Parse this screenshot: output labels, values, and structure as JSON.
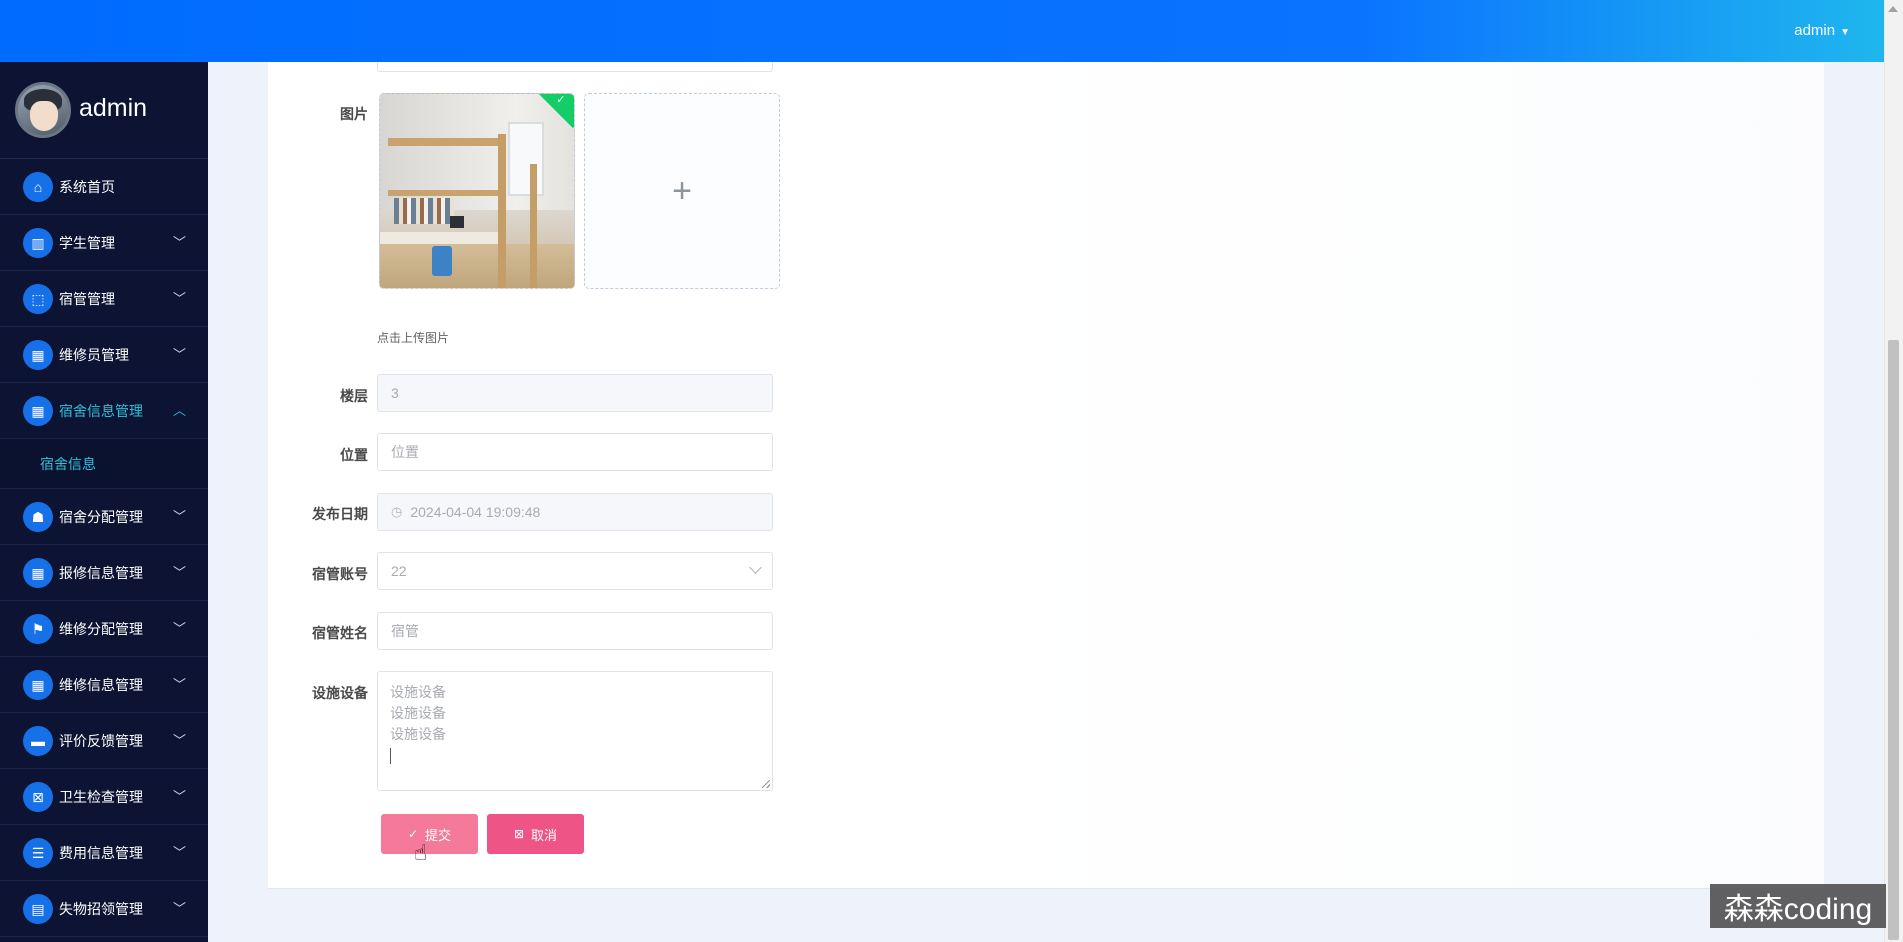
{
  "header": {
    "username": "admin",
    "caret": "▼"
  },
  "sidebar": {
    "profile_name": "admin",
    "items": [
      {
        "label": "系统首页",
        "icon": "home-icon",
        "glyph": "⌂",
        "has_arrow": false
      },
      {
        "label": "学生管理",
        "icon": "book-icon",
        "glyph": "▥",
        "has_arrow": true
      },
      {
        "label": "宿管管理",
        "icon": "chart-icon",
        "glyph": "⬚",
        "has_arrow": true
      },
      {
        "label": "维修员管理",
        "icon": "grid-icon",
        "glyph": "▦",
        "has_arrow": true
      },
      {
        "label": "宿舍信息管理",
        "icon": "grid-icon",
        "glyph": "▦",
        "has_arrow": true,
        "active": true
      },
      {
        "label": "宿舍分配管理",
        "icon": "thumb-icon",
        "glyph": "☗",
        "has_arrow": true
      },
      {
        "label": "报修信息管理",
        "icon": "grid-icon",
        "glyph": "▦",
        "has_arrow": true
      },
      {
        "label": "维修分配管理",
        "icon": "flag-icon",
        "glyph": "⚑",
        "has_arrow": true
      },
      {
        "label": "维修信息管理",
        "icon": "grid-icon",
        "glyph": "▦",
        "has_arrow": true
      },
      {
        "label": "评价反馈管理",
        "icon": "ticket-icon",
        "glyph": "▬",
        "has_arrow": true
      },
      {
        "label": "卫生检查管理",
        "icon": "clipboard-x-icon",
        "glyph": "⊠",
        "has_arrow": true
      },
      {
        "label": "费用信息管理",
        "icon": "list-icon",
        "glyph": "☰",
        "has_arrow": true
      },
      {
        "label": "失物招领管理",
        "icon": "clipboard-icon",
        "glyph": "▤",
        "has_arrow": true
      }
    ],
    "submenu_label": "宿舍信息",
    "arrow_down": "﹀",
    "arrow_up": "︿"
  },
  "form": {
    "image_label": "图片",
    "upload_plus": "+",
    "upload_tip": "点击上传图片",
    "floor_label": "楼层",
    "floor_value": "3",
    "location_label": "位置",
    "location_placeholder": "位置",
    "date_label": "发布日期",
    "date_value": "2024-04-04 19:09:48",
    "account_label": "宿管账号",
    "account_value": "22",
    "name_label": "宿管姓名",
    "name_placeholder": "宿管",
    "facility_label": "设施设备",
    "facility_lines": [
      "设施设备",
      "设施设备",
      "设施设备"
    ],
    "submit_label": "提交",
    "cancel_label": "取消"
  },
  "watermark": "森森coding",
  "colors": {
    "topbar_start": "#006cff",
    "topbar_end": "#1fb6ee",
    "sidebar_bg": "#0d1433",
    "sidebar_active": "#2fc0d8",
    "submit": "#f57a9a",
    "cancel": "#ee5586",
    "upload_success": "#13ce66"
  }
}
